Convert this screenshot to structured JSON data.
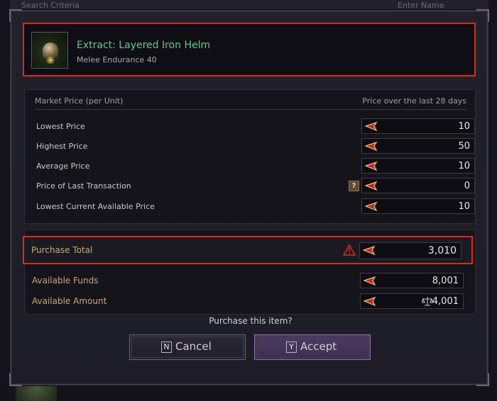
{
  "background": {
    "left_hint": "Search Criteria",
    "right_hint": "Enter Name"
  },
  "item": {
    "name": "Extract: Layered Iron Helm",
    "subtitle": "Melee Endurance 40",
    "name_color": "#62c88c"
  },
  "market": {
    "header_left": "Market Price (per Unit)",
    "header_right": "Price over the last 28 days",
    "rows": [
      {
        "label": "Lowest Price",
        "value": "10"
      },
      {
        "label": "Highest Price",
        "value": "50"
      },
      {
        "label": "Average Price",
        "value": "10"
      },
      {
        "label": "Price of Last Transaction",
        "value": "0",
        "help": "?"
      },
      {
        "label": "Lowest Current Available Price",
        "value": "10"
      }
    ]
  },
  "totals": {
    "purchase_total_label": "Purchase Total",
    "purchase_total_value": "3,010",
    "available_funds_label": "Available Funds",
    "available_funds_value": "8,001",
    "available_amount_label": "Available Amount",
    "available_amount_value": "4,001"
  },
  "dialog": {
    "prompt": "Purchase this item?",
    "cancel_key": "N",
    "cancel_label": "Cancel",
    "accept_key": "Y",
    "accept_label": "Accept"
  },
  "colors": {
    "highlight": "#e0271f",
    "accept": "#4d3b63",
    "label_gold": "#c7a77e"
  },
  "icons": {
    "currency": "coin-icon",
    "warning": "warning-icon",
    "help": "help-icon",
    "scale": "scale-icon"
  }
}
